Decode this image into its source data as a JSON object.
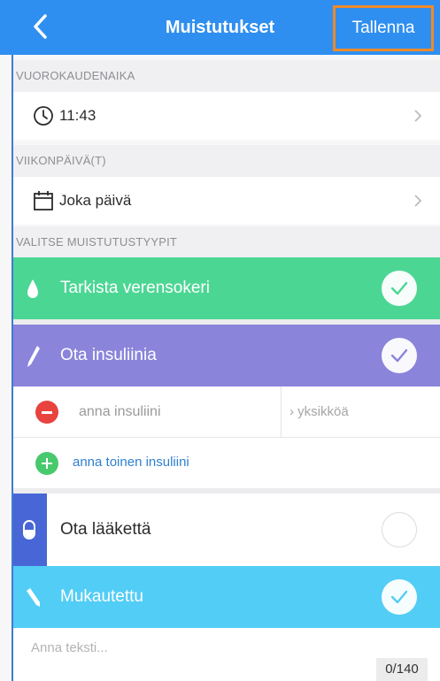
{
  "header": {
    "title": "Muistutukset",
    "save_label": "Tallenna",
    "back_icon": "chevron-left-icon"
  },
  "time_section": {
    "heading": "VUOROKAUDENAIKA",
    "value": "11:43",
    "icon": "clock-icon"
  },
  "weekday_section": {
    "heading": "VIIKONPÄIVÄ(T)",
    "value": "Joka päivä",
    "icon": "calendar-icon"
  },
  "types_section": {
    "heading": "VALITSE MUISTUTUSTYYPIT"
  },
  "reminder_types": {
    "blood_sugar": {
      "label": "Tarkista verensokeri",
      "checked": true,
      "color": "#4cd694"
    },
    "insulin": {
      "label": "Ota insuliinia",
      "checked": true,
      "color": "#8a84db"
    },
    "medicine": {
      "label": "Ota lääkettä",
      "checked": false,
      "color": "#4866d6"
    },
    "custom": {
      "label": "Mukautettu",
      "checked": true,
      "color": "#52cdf5"
    }
  },
  "insulin_entry": {
    "insulin_placeholder": "anna insuliini",
    "unit_placeholder": "› yksikköä",
    "add_label": "anna toinen insuliini"
  },
  "custom_text": {
    "placeholder": "Anna teksti...",
    "counter": "0/140"
  },
  "colors": {
    "header_bg": "#2f8ff0",
    "save_outline": "#f08a2a",
    "link": "#2f7fd1",
    "remove": "#e8433f",
    "add": "#48c96e"
  }
}
